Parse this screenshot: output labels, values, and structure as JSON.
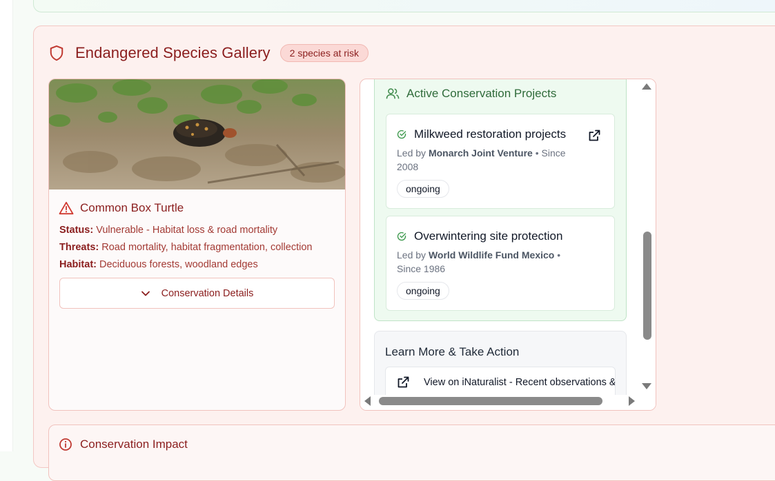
{
  "gallery": {
    "title": "Endangered Species Gallery",
    "badge": "2 species at risk",
    "icon": "shield-icon",
    "accent_color": "#8b1e1e"
  },
  "species": {
    "name": "Common Box Turtle",
    "status_label": "Status:",
    "status_value": "Vulnerable - Habitat loss & road mortality",
    "threats_label": "Threats:",
    "threats_value": "Road mortality, habitat fragmentation, collection",
    "habitat_label": "Habitat:",
    "habitat_value": "Deciduous forests, woodland edges",
    "details_button": "Conservation Details"
  },
  "projects": {
    "heading": "Active Conservation Projects",
    "items": [
      {
        "title": "Milkweed restoration projects",
        "led_prefix": "Led by",
        "org": "Monarch Joint Venture",
        "since": "• Since 2008",
        "status": "ongoing"
      },
      {
        "title": "Overwintering site protection",
        "led_prefix": "Led by",
        "org": "World Wildlife Fund Mexico",
        "since": "• Since 1986",
        "status": "ongoing"
      }
    ]
  },
  "learn": {
    "title": "Learn More & Take Action",
    "link_text": "View on iNaturalist - Recent observations & photos"
  },
  "impact": {
    "title": "Conservation Impact"
  }
}
